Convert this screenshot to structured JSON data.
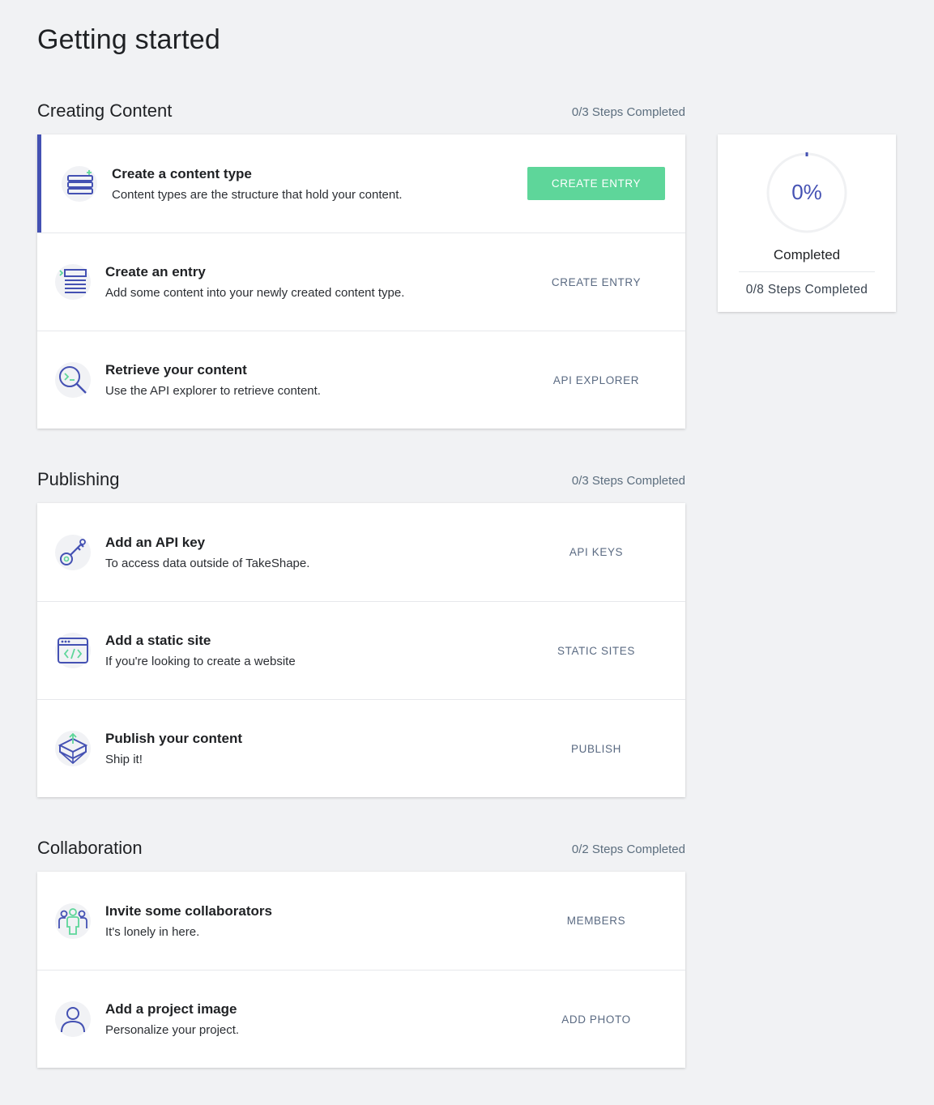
{
  "page": {
    "title": "Getting started"
  },
  "colors": {
    "accent": "#4451b3",
    "success": "#5ed69a",
    "muted": "#5c6e7e",
    "background": "#f1f2f4"
  },
  "sections": [
    {
      "title": "Creating Content",
      "progress": "0/3 Steps Completed",
      "steps": [
        {
          "title": "Create a content type",
          "description": "Content types are the structure that hold your content.",
          "action": "CREATE ENTRY",
          "icon": "content-type-icon",
          "active": true
        },
        {
          "title": "Create an entry",
          "description": "Add some content into your newly created content type.",
          "action": "CREATE ENTRY",
          "icon": "entry-list-icon",
          "active": false
        },
        {
          "title": "Retrieve your content",
          "description": "Use the API explorer to retrieve content.",
          "action": "API EXPLORER",
          "icon": "search-terminal-icon",
          "active": false
        }
      ]
    },
    {
      "title": "Publishing",
      "progress": "0/3 Steps Completed",
      "steps": [
        {
          "title": "Add an API key",
          "description": "To access data outside of TakeShape.",
          "action": "API KEYS",
          "icon": "key-icon",
          "active": false
        },
        {
          "title": "Add a static site",
          "description": "If you're looking to create a website",
          "action": "STATIC SITES",
          "icon": "browser-code-icon",
          "active": false
        },
        {
          "title": "Publish your content",
          "description": "Ship it!",
          "action": "PUBLISH",
          "icon": "publish-box-icon",
          "active": false
        }
      ]
    },
    {
      "title": "Collaboration",
      "progress": "0/2 Steps Completed",
      "steps": [
        {
          "title": "Invite some collaborators",
          "description": "It's lonely in here.",
          "action": "MEMBERS",
          "icon": "collaborators-icon",
          "active": false
        },
        {
          "title": "Add a project image",
          "description": "Personalize your project.",
          "action": "ADD PHOTO",
          "icon": "user-avatar-icon",
          "active": false
        }
      ]
    }
  ],
  "summary": {
    "percent_label": "0%",
    "percent_value": 0,
    "label": "Completed",
    "steps": "0/8 Steps Completed"
  }
}
